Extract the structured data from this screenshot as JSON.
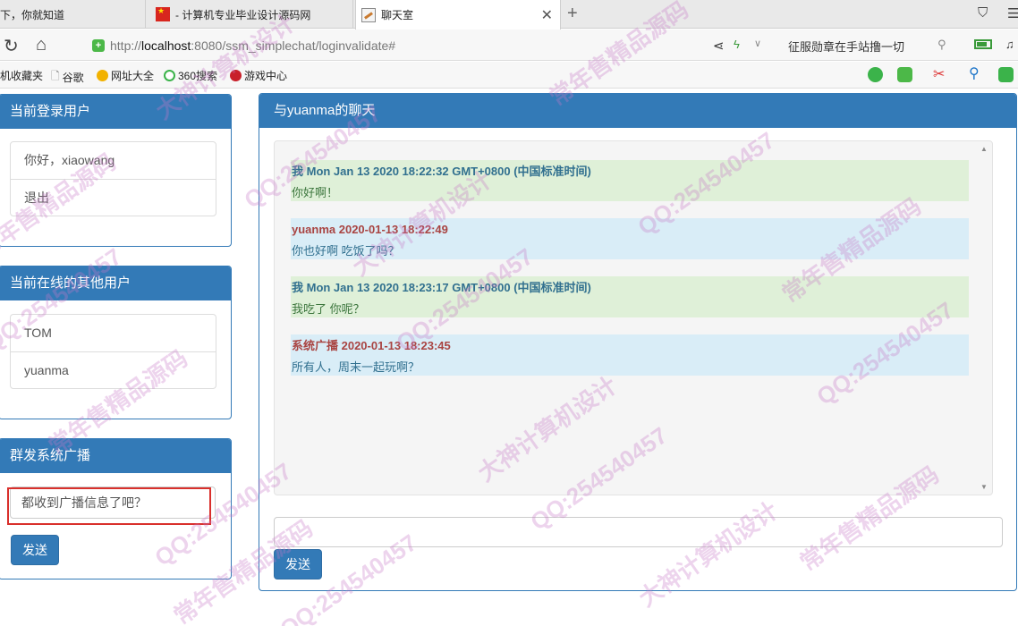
{
  "browser": {
    "tabs": [
      {
        "title": "下，你就知道"
      },
      {
        "title": "- 计算机专业毕业设计源码网"
      },
      {
        "title": "聊天室"
      }
    ],
    "url_prefix": "http://",
    "url_host": "localhost",
    "url_rest": ":8080/ssm_simplechat/loginvalidate#",
    "news_text": "征服勋章在手站撸一切",
    "bookmarks": [
      "机收藏夹",
      "谷歌",
      "网址大全",
      "360搜索",
      "游戏中心"
    ]
  },
  "user_panel": {
    "title": "当前登录用户",
    "greeting": "你好，xiaowang",
    "logout": "退出"
  },
  "online_panel": {
    "title": "当前在线的其他用户",
    "users": [
      "TOM",
      "yuanma"
    ]
  },
  "broadcast_panel": {
    "title": "群发系统广播",
    "input_value": "都收到广播信息了吧？",
    "send_label": "发送"
  },
  "chat_panel": {
    "title": "与yuanma的聊天",
    "messages": [
      {
        "header": "我 Mon Jan 13 2020 18:22:32 GMT+0800 (中国标准时间)",
        "body": "你好啊！"
      },
      {
        "header": "yuanma 2020-01-13 18:22:49",
        "body": "你也好啊 吃饭了吗？"
      },
      {
        "header": "我 Mon Jan 13 2020 18:23:17 GMT+0800 (中国标准时间)",
        "body": "我吃了 你呢？"
      },
      {
        "header": "系统广播 2020-01-13 18:23:45",
        "body": "所有人，周末一起玩啊？"
      }
    ],
    "input_value": "",
    "send_label": "发送"
  },
  "watermark": {
    "qq": "QQ:254540457",
    "t1": "常年售精品源码",
    "t2": "大神计算机设计"
  }
}
